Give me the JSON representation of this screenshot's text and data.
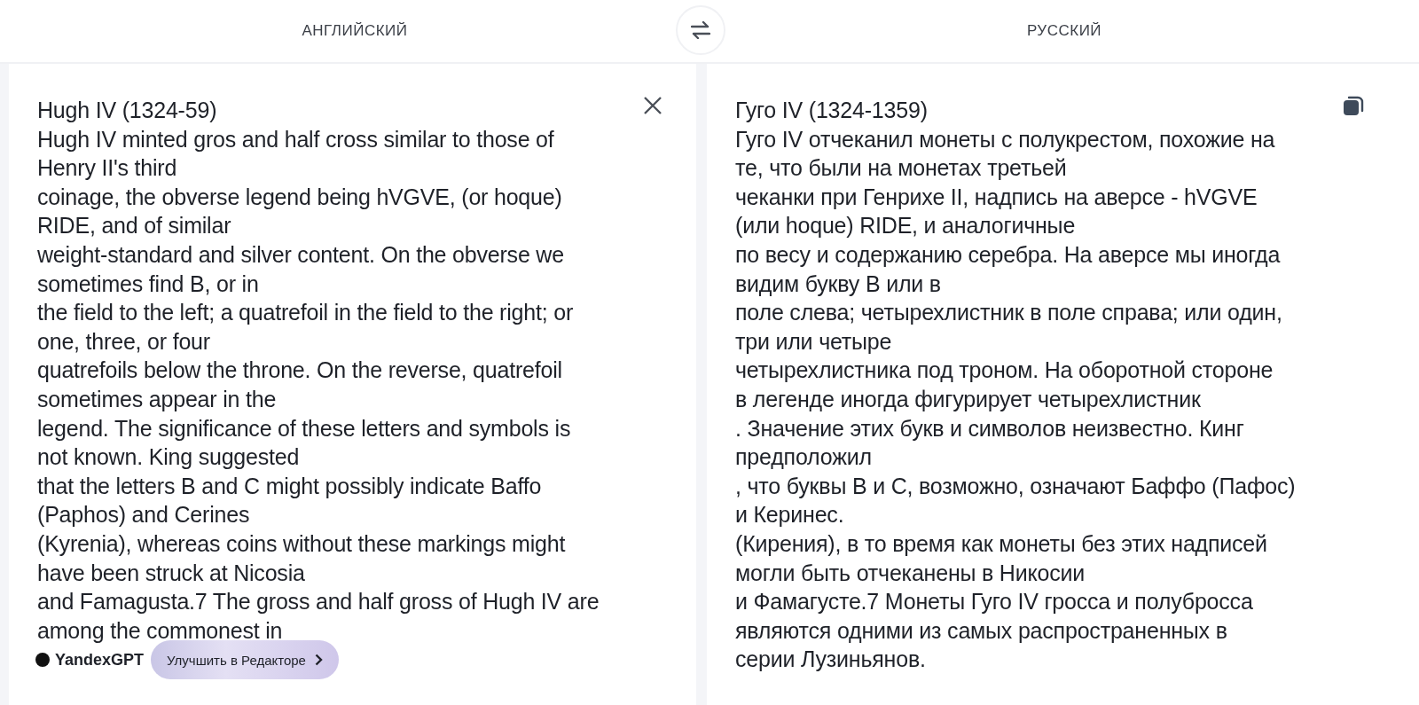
{
  "header": {
    "source_language": "АНГЛИЙСКИЙ",
    "target_language": "РУССКИЙ"
  },
  "source": {
    "lines": [
      "Hugh IV (1324-59)",
      "Hugh IV minted gros and half cross similar to those of",
      "Henry II's third",
      "coinage, the obverse legend being hVGVE, (or hoque)",
      "RIDE, and of similar",
      "weight-standard and silver content. On the obverse we",
      "sometimes find B, or in",
      "the field to the left; a quatrefoil in the field to the right; or",
      "one, three, or four",
      "quatrefoils below the throne. On the reverse, quatrefoil",
      "sometimes appear in the",
      "legend. The significance of these letters and symbols is",
      "not known. King suggested",
      "that the letters B and C might possibly indicate Baffo",
      "(Paphos) and Cerines",
      "(Kyrenia), whereas coins without these markings might",
      "have been struck at Nicosia",
      "and Famagusta.7 The gross and half gross of Hugh IV are",
      "among the commonest in"
    ],
    "gpt_label": "YandexGPT",
    "improve_button": "Улучшить в Редакторе"
  },
  "target": {
    "lines": [
      "Гуго IV (1324-1359)",
      "Гуго IV отчеканил монеты с полукрестом, похожие на",
      "те, что были на монетах третьей",
      "чеканки при Генрихе II, надпись на аверсе - hVGVE",
      "(или hoque) RIDE, и аналогичные",
      "по весу и содержанию серебра. На аверсе мы иногда",
      "видим букву B или в",
      "поле слева; четырехлистник в поле справа; или один,",
      "три или четыре",
      "четырехлистника под троном. На оборотной стороне",
      "в легенде иногда фигурирует четырехлистник",
      ". Значение этих букв и символов неизвестно. Кинг",
      "предположил",
      ", что буквы B и C, возможно, означают Баффо (Пафос)",
      "и Керинес.",
      "(Кирения), в то время как монеты без этих надписей",
      "могли быть отчеканены в Никосии",
      "и Фамагусте.7 Монеты Гуго IV гросса и полубросса",
      "являются одними из самых распространенных в",
      "серии Лузиньянов."
    ]
  }
}
